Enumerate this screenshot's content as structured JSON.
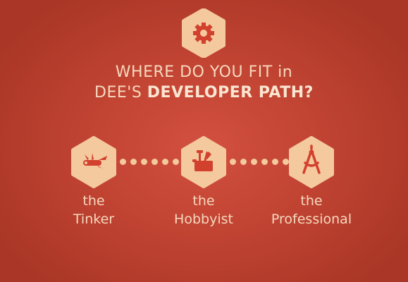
{
  "colors": {
    "background": "#c24433",
    "hexagon": "#f4c99e",
    "icon": "#d2402e",
    "text": "#f6d9bf"
  },
  "heading": {
    "line1": "WHERE DO YOU FIT in",
    "line2_prefix": "DEE'S ",
    "line2_bold": "DEVELOPER PATH?"
  },
  "top_icon": "gear-icon",
  "path": [
    {
      "icon": "swiss-knife-icon",
      "label_line1": "the",
      "label_line2": "Tinker"
    },
    {
      "icon": "toolbox-icon",
      "label_line1": "the",
      "label_line2": "Hobbyist"
    },
    {
      "icon": "compass-icon",
      "label_line1": "the",
      "label_line2": "Professional"
    }
  ]
}
